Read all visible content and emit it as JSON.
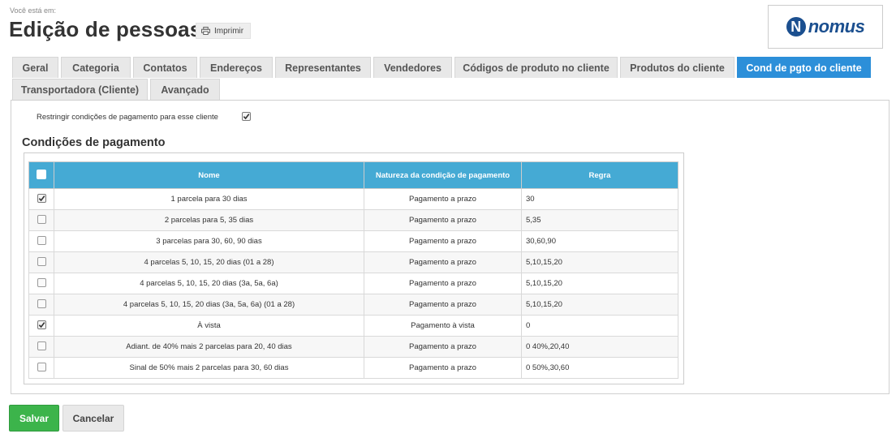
{
  "breadcrumb": "Você está em:",
  "title": "Edição de pessoas",
  "print_label": "Imprimir",
  "logo": {
    "mark": "N",
    "text": "nomus",
    "color": "#1b4f8f"
  },
  "tabs": [
    {
      "label": "Geral"
    },
    {
      "label": "Categoria"
    },
    {
      "label": "Contatos"
    },
    {
      "label": "Endereços"
    },
    {
      "label": "Representantes"
    },
    {
      "label": "Vendedores"
    },
    {
      "label": "Códigos de produto no cliente"
    },
    {
      "label": "Produtos do cliente"
    },
    {
      "label": "Cond de pgto do cliente",
      "active": true
    },
    {
      "label": "Transportadora (Cliente)"
    },
    {
      "label": "Avançado"
    }
  ],
  "restrict": {
    "label": "Restringir condições de pagamento para esse cliente",
    "checked": true
  },
  "section_title": "Condições de pagamento",
  "table": {
    "headers": {
      "nome": "Nome",
      "natureza": "Natureza da condição de pagamento",
      "regra": "Regra"
    },
    "rows": [
      {
        "checked": true,
        "nome": "1 parcela para 30 dias",
        "natureza": "Pagamento a prazo",
        "regra": "30"
      },
      {
        "checked": false,
        "nome": "2 parcelas para 5, 35 dias",
        "natureza": "Pagamento a prazo",
        "regra": "5,35"
      },
      {
        "checked": false,
        "nome": "3 parcelas para 30, 60, 90 dias",
        "natureza": "Pagamento a prazo",
        "regra": "30,60,90"
      },
      {
        "checked": false,
        "nome": "4 parcelas 5, 10, 15, 20 dias (01 a 28)",
        "natureza": "Pagamento a prazo",
        "regra": "5,10,15,20"
      },
      {
        "checked": false,
        "nome": "4 parcelas 5, 10, 15, 20 dias (3a, 5a, 6a)",
        "natureza": "Pagamento a prazo",
        "regra": "5,10,15,20"
      },
      {
        "checked": false,
        "nome": "4 parcelas 5, 10, 15, 20 dias (3a, 5a, 6a) (01 a 28)",
        "natureza": "Pagamento a prazo",
        "regra": "5,10,15,20"
      },
      {
        "checked": true,
        "nome": "À vista",
        "natureza": "Pagamento à vista",
        "regra": "0"
      },
      {
        "checked": false,
        "nome": "Adiant. de 40% mais 2 parcelas para 20, 40 dias",
        "natureza": "Pagamento a prazo",
        "regra": "0 40%,20,40"
      },
      {
        "checked": false,
        "nome": "Sinal de 50% mais 2 parcelas para 30, 60 dias",
        "natureza": "Pagamento a prazo",
        "regra": "0 50%,30,60"
      }
    ]
  },
  "buttons": {
    "save": "Salvar",
    "cancel": "Cancelar"
  },
  "colors": {
    "accent": "#2c8fd9",
    "header": "#45aad4",
    "save": "#3cb44b"
  }
}
